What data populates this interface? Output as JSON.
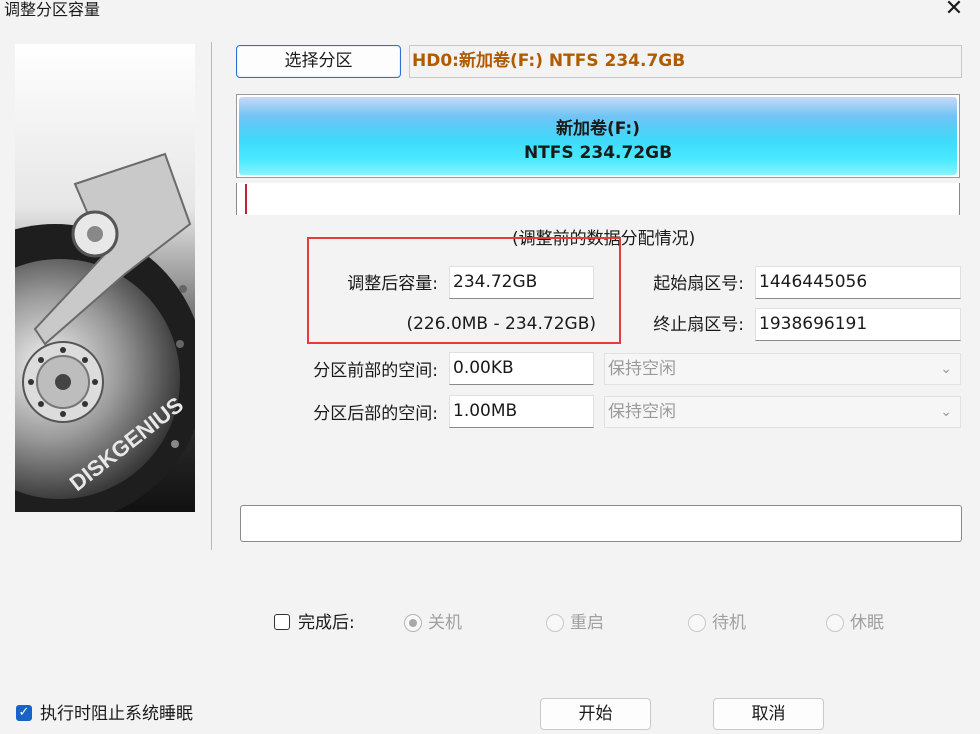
{
  "window": {
    "title": "调整分区容量",
    "close_glyph": "✕"
  },
  "brand": {
    "logo_text": "DISKGENIUS"
  },
  "select_partition": {
    "button_label": "选择分区",
    "partition_info": "HD0:新加卷(F:) NTFS 234.7GB"
  },
  "partition_bar": {
    "name": "新加卷(F:)",
    "detail": "NTFS 234.72GB"
  },
  "caption": "(调整前的数据分配情况)",
  "form": {
    "new_size": {
      "label": "调整后容量:",
      "value": "234.72GB",
      "range": "(226.0MB - 234.72GB)"
    },
    "start_sector": {
      "label": "起始扇区号:",
      "value": "1446445056"
    },
    "end_sector": {
      "label": "终止扇区号:",
      "value": "1938696191"
    },
    "space_before": {
      "label": "分区前部的空间:",
      "value": "0.00KB",
      "option": "保持空闲"
    },
    "space_after": {
      "label": "分区后部的空间:",
      "value": "1.00MB",
      "option": "保持空闲"
    }
  },
  "after_completion": {
    "label": "完成后:",
    "checked": false,
    "options": [
      {
        "label": "关机",
        "selected": true
      },
      {
        "label": "重启",
        "selected": false
      },
      {
        "label": "待机",
        "selected": false
      },
      {
        "label": "休眠",
        "selected": false
      }
    ]
  },
  "prevent_sleep": {
    "label": "执行时阻止系统睡眠",
    "checked": true
  },
  "buttons": {
    "start": "开始",
    "cancel": "取消"
  },
  "colors": {
    "accent": "#1763c7",
    "partition_info_text": "#b05b00",
    "highlight_box": "#e23c3c"
  }
}
